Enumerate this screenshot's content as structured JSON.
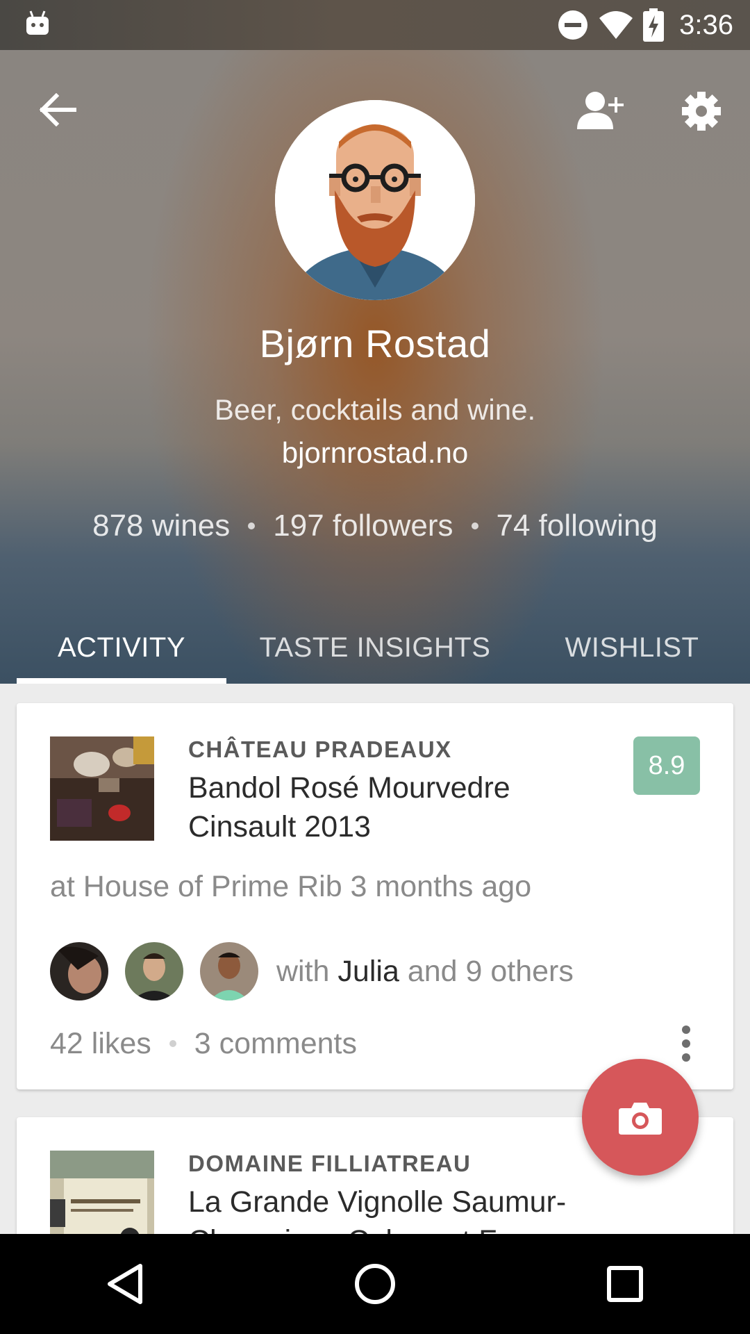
{
  "status_bar": {
    "time": "3:36",
    "icons": [
      "android-icon",
      "do-not-disturb-icon",
      "wifi-icon",
      "battery-charging-icon"
    ]
  },
  "header": {
    "back_icon": "arrow-back-icon",
    "add_friend_icon": "person-add-icon",
    "settings_icon": "gear-icon",
    "name": "Bjørn Rostad",
    "bio": "Beer, cocktails and wine.",
    "website": "bjornrostad.no",
    "stats": {
      "wines": "878 wines",
      "followers": "197 followers",
      "following": "74 following"
    }
  },
  "tabs": [
    {
      "label": "ACTIVITY",
      "active": true
    },
    {
      "label": "TASTE INSIGHTS",
      "active": false
    },
    {
      "label": "WISHLIST",
      "active": false
    }
  ],
  "feed": [
    {
      "winery": "CHÂTEAU PRADEAUX",
      "wine": "Bandol Rosé Mourvedre Cinsault 2013",
      "rating": "8.9",
      "location": "at House of Prime Rib 3 months ago",
      "with_prefix": "with",
      "with_name": "Julia",
      "with_suffix": "and 9 others",
      "likes": "42 likes",
      "comments": "3 comments"
    },
    {
      "winery": "DOMAINE FILLIATREAU",
      "wine": "La Grande Vignolle Saumur-Champigny Cabernet F..."
    }
  ],
  "fab_icon": "camera-icon",
  "colors": {
    "rating": "#88c0a6",
    "fab": "#d6575a",
    "tab_indicator": "#ffffff"
  },
  "nav_bar": [
    "back-triangle-icon",
    "home-circle-icon",
    "recents-square-icon"
  ]
}
